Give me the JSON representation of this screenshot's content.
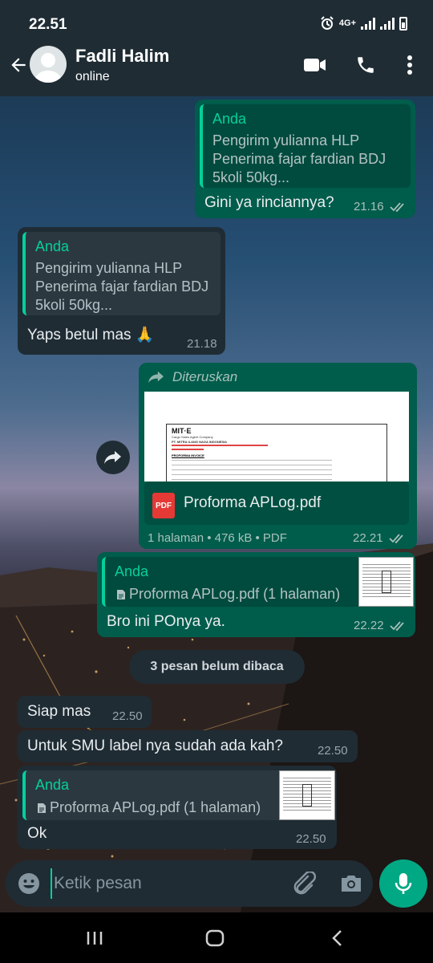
{
  "status_bar": {
    "time": "22.51",
    "network": "4G+"
  },
  "header": {
    "contact_name": "Fadli Halim",
    "contact_status": "online"
  },
  "messages": {
    "m1": {
      "quote_author": "Anda",
      "quote_text": "Pengirim yulianna HLP\nPenerima fajar fardian BDJ\n5koli 50kg...",
      "text": "Gini ya rinciannya?",
      "time": "21.16"
    },
    "m2": {
      "quote_author": "Anda",
      "quote_text": "Pengirim yulianna HLP\nPenerima fajar fardian BDJ\n5koli 50kg...",
      "text": "Yaps betul mas 🙏",
      "time": "21.18"
    },
    "m3": {
      "forwarded_label": "Diteruskan",
      "file_name": "Proforma APLog.pdf",
      "file_meta": "1 halaman • 476 kB • PDF",
      "time": "22.21",
      "preview": {
        "brand": "MIT·E",
        "company": "Cargo Sales Agent Company",
        "company2": "PT. MITRA ILANG NAGA INDONESIA",
        "title": "PROFORMA INVOICE"
      }
    },
    "m4": {
      "quote_author": "Anda",
      "quote_text": "Proforma APLog.pdf (1 halaman)",
      "text": "Bro ini POnya ya.",
      "time": "22.22"
    },
    "unread": "3 pesan belum dibaca",
    "m5": {
      "text": "Siap mas",
      "time": "22.50"
    },
    "m6": {
      "text": "Untuk SMU label nya sudah ada kah?",
      "time": "22.50"
    },
    "m7": {
      "quote_author": "Anda",
      "quote_text": "Proforma APLog.pdf (1 halaman)",
      "text": "Ok",
      "time": "22.50"
    }
  },
  "input": {
    "placeholder": "Ketik pesan"
  },
  "colors": {
    "accent": "#00a884",
    "outgoing_bubble": "#005c4b",
    "incoming_bubble": "#1f2c34",
    "quote_author": "#06cf9c",
    "header": "#1f2c34"
  },
  "icons": [
    "back-arrow-icon",
    "video-call-icon",
    "phone-icon",
    "more-vert-icon",
    "forward-icon",
    "pdf-icon",
    "document-icon",
    "double-check-icon",
    "emoji-icon",
    "attach-icon",
    "camera-icon",
    "mic-icon",
    "recents-icon",
    "home-icon",
    "nav-back-icon"
  ]
}
